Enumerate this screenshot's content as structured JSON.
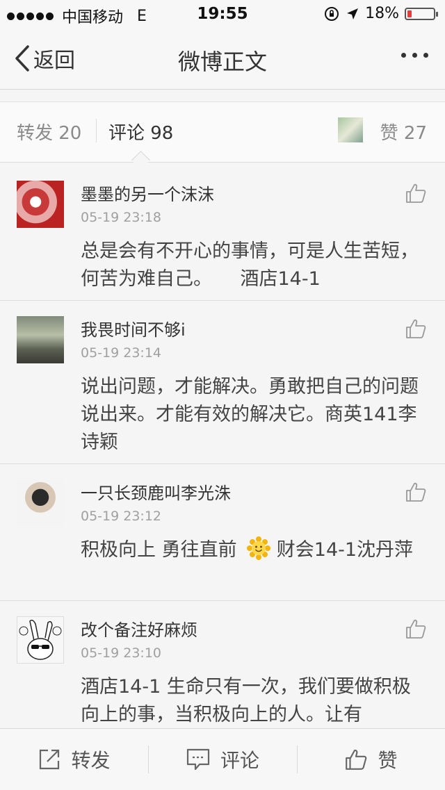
{
  "statusbar": {
    "carrier": "中国移动",
    "network": "E",
    "time": "19:55",
    "battery_text": "18%",
    "battery_level": 0.18,
    "icons": [
      "rotation-lock-icon",
      "location-arrow-icon",
      "battery-icon"
    ]
  },
  "navbar": {
    "back_label": "返回",
    "title": "微博正文"
  },
  "tabs": {
    "repost": "转发 20",
    "comment": "评论 98",
    "like": "赞 27"
  },
  "comments": [
    {
      "name": "墨墨的另一个沫沫",
      "time": "05-19 23:18",
      "text": "总是会有不开心的事情，可是人生苦短，何苦为难自己。　　酒店14-1"
    },
    {
      "name": "我畏时间不够i",
      "time": "05-19 23:14",
      "text": "说出问题，才能解决。勇敢把自己的问题说出来。才能有效的解决它。商英141李诗颖"
    },
    {
      "name": "一只长颈鹿叫李光洙",
      "time": "05-19 23:12",
      "text_before": "积极向上 勇往直前",
      "text_after": " 财会14-1沈丹萍"
    },
    {
      "name": "改个备注好麻烦",
      "time": "05-19 23:10",
      "text": "酒店14-1 生命只有一次，我们要做积极向上的事，当积极向上的人。让有"
    }
  ],
  "toolbar": {
    "repost": "转发",
    "comment": "评论",
    "like": "赞"
  },
  "colors": {
    "accent_battery": "#e23c3c",
    "text_primary": "#333333",
    "text_muted": "#a0a0a0"
  }
}
